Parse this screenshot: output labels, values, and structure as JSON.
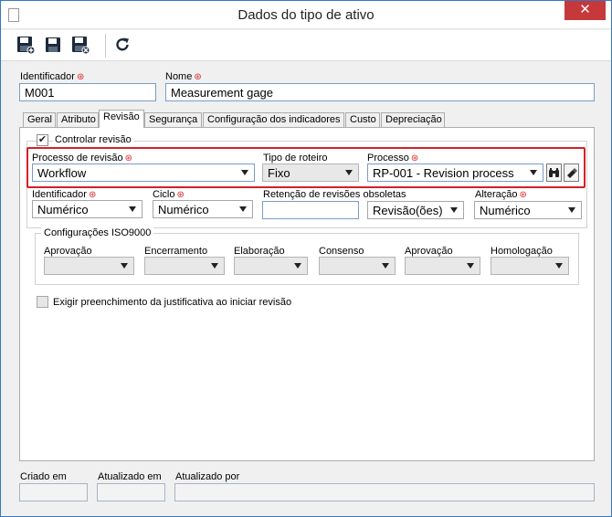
{
  "window": {
    "title": "Dados do tipo de ativo",
    "close_symbol": "✕"
  },
  "header": {
    "id_label": "Identificador",
    "id_value": "M001",
    "name_label": "Nome",
    "name_value": "Measurement gage"
  },
  "tabs": [
    {
      "label": "Geral"
    },
    {
      "label": "Atributo"
    },
    {
      "label": "Revisão"
    },
    {
      "label": "Segurança"
    },
    {
      "label": "Configuração dos indicadores"
    },
    {
      "label": "Custo"
    },
    {
      "label": "Depreciação"
    }
  ],
  "revision": {
    "control_label": "Controlar revisão",
    "control_checked": "✔",
    "process_label": "Processo de revisão",
    "process_value": "Workflow",
    "route_label": "Tipo de roteiro",
    "route_value": "Fixo",
    "processo_label": "Processo",
    "processo_value": "RP-001 - Revision process",
    "identifier_label": "Identificador",
    "identifier_value": "Numérico",
    "cycle_label": "Ciclo",
    "cycle_value": "Numérico",
    "retention_label": "Retenção de revisões obsoletas",
    "retention_value": "",
    "retention_unit": "Revisão(ões)",
    "change_label": "Alteração",
    "change_value": "Numérico",
    "iso_group_label": "Configurações ISO9000",
    "iso_fields": [
      {
        "label": "Aprovação"
      },
      {
        "label": "Encerramento"
      },
      {
        "label": "Elaboração"
      },
      {
        "label": "Consenso"
      },
      {
        "label": "Aprovação"
      },
      {
        "label": "Homologação"
      }
    ],
    "justification_label": "Exigir preenchimento da justificativa ao iniciar revisão"
  },
  "footer": {
    "created_label": "Criado em",
    "updated_label": "Atualizado em",
    "updated_by_label": "Atualizado por"
  },
  "colors": {
    "required": "#d8262b",
    "highlight": "#d42027",
    "close": "#c7383a"
  }
}
